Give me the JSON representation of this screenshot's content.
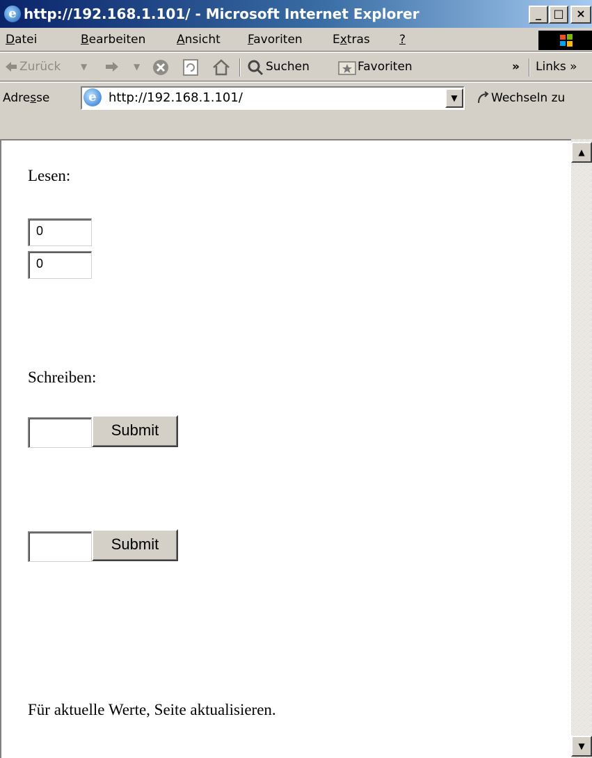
{
  "window": {
    "title": "http://192.168.1.101/ - Microsoft Internet Explorer",
    "controls": {
      "minimize": "_",
      "maximize": "□",
      "close": "×"
    }
  },
  "menu": {
    "items": [
      {
        "pre": "",
        "key": "D",
        "post": "atei"
      },
      {
        "pre": "",
        "key": "B",
        "post": "earbeiten"
      },
      {
        "pre": "",
        "key": "A",
        "post": "nsicht"
      },
      {
        "pre": "",
        "key": "F",
        "post": "avoriten"
      },
      {
        "pre": "E",
        "key": "x",
        "post": "tras"
      },
      {
        "pre": "",
        "key": "?",
        "post": ""
      }
    ]
  },
  "toolbar": {
    "back_label": "Zurück",
    "search_label": "Suchen",
    "favorites_label": "Favoriten",
    "chevron": "»",
    "links_label": "Links »"
  },
  "address": {
    "label_pre": "Adre",
    "label_key": "s",
    "label_post": "se",
    "url": "http://192.168.1.101/",
    "go_label": "Wechseln zu"
  },
  "page": {
    "read_heading": "Lesen:",
    "read_values": [
      "0",
      "0"
    ],
    "write_heading": "Schreiben:",
    "write_inputs": [
      "",
      ""
    ],
    "submit_label": "Submit",
    "footer_text": "Für aktuelle Werte, Seite aktualisieren."
  },
  "icons": {
    "ie": "ie-logo-icon",
    "back": "back-arrow-icon",
    "forward": "forward-arrow-icon",
    "stop": "stop-icon",
    "refresh": "refresh-icon",
    "home": "home-icon",
    "search": "search-icon",
    "favorites": "favorites-icon",
    "go": "go-arrow-icon",
    "windows": "windows-logo-icon"
  },
  "colors": {
    "titlebar_start": "#0a246a",
    "titlebar_end": "#a6caf0",
    "chrome": "#d4d0c8"
  }
}
